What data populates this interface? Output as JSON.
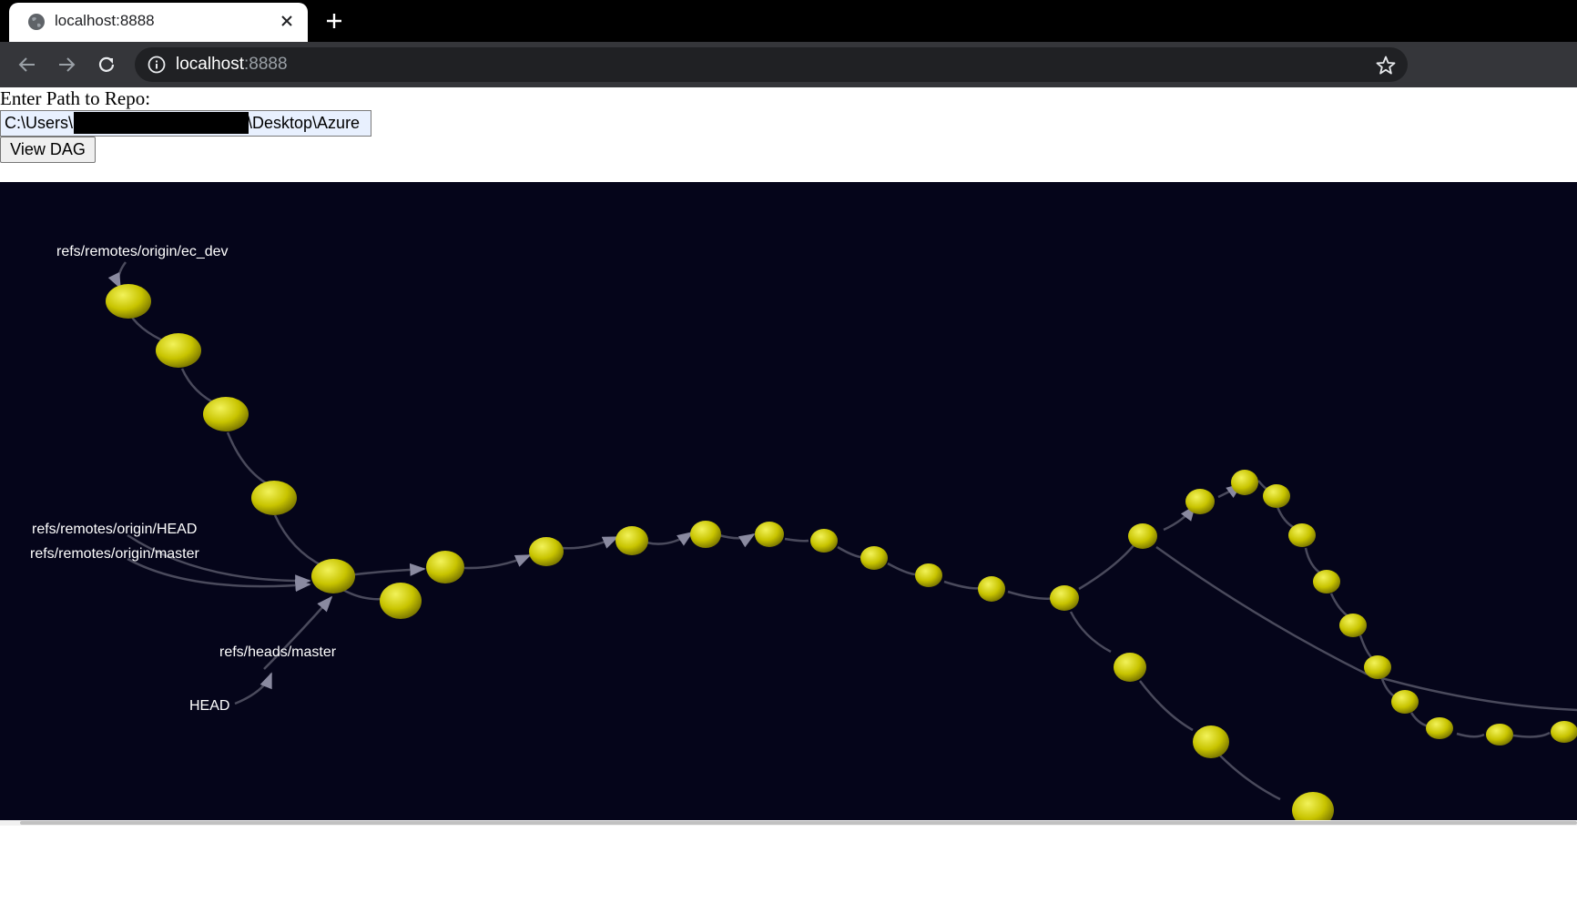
{
  "browser": {
    "tab": {
      "title": "localhost:8888",
      "favicon": "globe-icon",
      "close_icon": "close-icon"
    },
    "new_tab_icon": "plus-icon",
    "nav": {
      "back_icon": "arrow-left-icon",
      "forward_icon": "arrow-right-icon",
      "reload_icon": "reload-icon"
    },
    "address": {
      "host": "localhost",
      "port": ":8888",
      "info_icon": "info-icon",
      "bookmark_icon": "star-icon"
    }
  },
  "form": {
    "label": "Enter Path to Repo:",
    "path_prefix": "C:\\Users\\",
    "path_suffix": "\\Desktop\\Azure",
    "button_label": "View DAG"
  },
  "graph": {
    "background": "#05051a",
    "node_color": "#c8c800",
    "edge_color": "#4a4a5c",
    "labels": {
      "ec_dev": "refs/remotes/origin/ec_dev",
      "origin_head": "refs/remotes/origin/HEAD",
      "origin_master": "refs/remotes/origin/master",
      "heads_master": "refs/heads/master",
      "head": "HEAD"
    }
  }
}
